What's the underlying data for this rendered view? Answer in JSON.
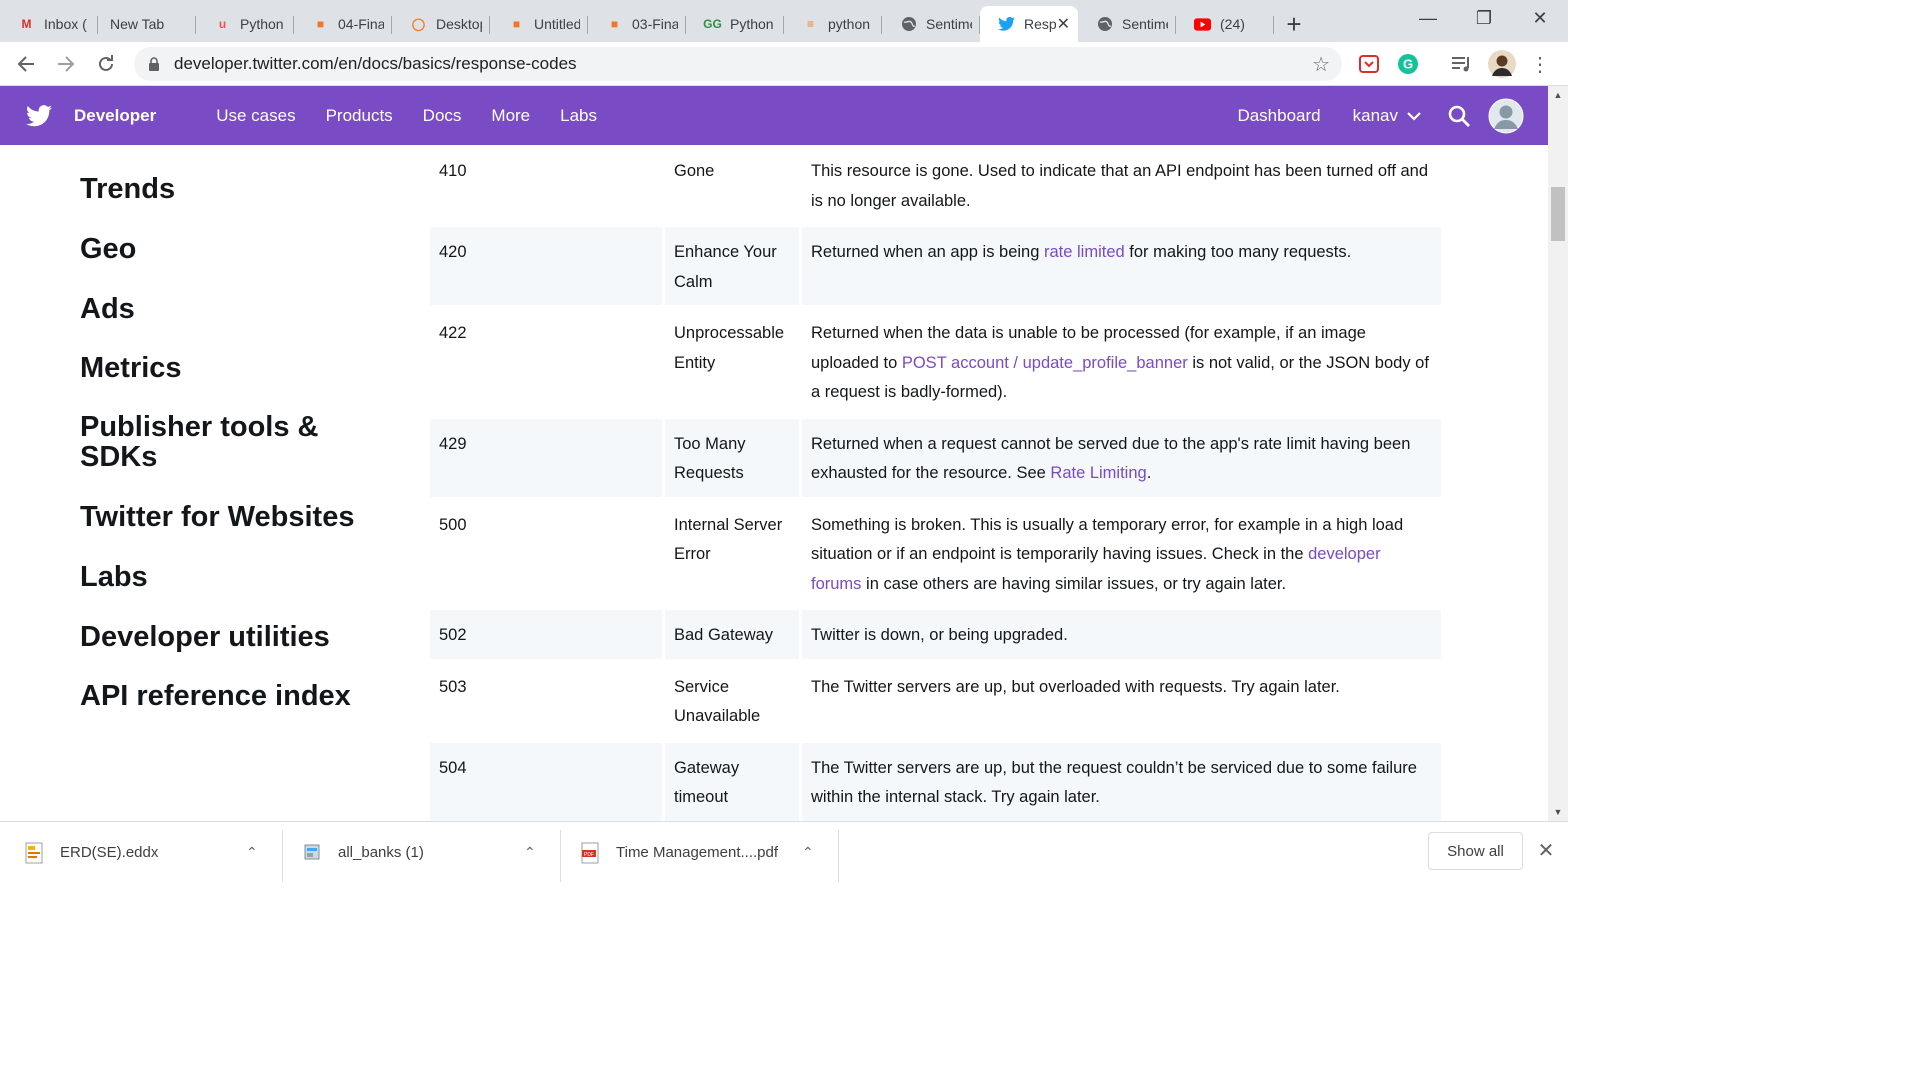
{
  "browser": {
    "tabs": [
      {
        "title": "Inbox (",
        "icon": "gmail-icon",
        "color": "#d93025"
      },
      {
        "title": "New Tab",
        "icon": "none"
      },
      {
        "title": "Python",
        "icon": "udemy-icon",
        "color": "#ec5252"
      },
      {
        "title": "04-Fina",
        "icon": "notebook-icon",
        "color": "#f37626"
      },
      {
        "title": "Desktop",
        "icon": "jupyter-icon",
        "color": "#f37626"
      },
      {
        "title": "Untitled",
        "icon": "notebook-icon",
        "color": "#f37626"
      },
      {
        "title": "03-Fina",
        "icon": "notebook-icon",
        "color": "#f37626"
      },
      {
        "title": "Python",
        "icon": "geeksforgeeks-icon",
        "color": "#2f8d46"
      },
      {
        "title": "python",
        "icon": "stackoverflow-icon",
        "color": "#f48024"
      },
      {
        "title": "Sentime",
        "icon": "globe-icon",
        "color": "#5f6368"
      },
      {
        "title": "Resp",
        "icon": "twitter-icon",
        "color": "#1da1f2",
        "active": true
      },
      {
        "title": "Sentime",
        "icon": "globe-icon",
        "color": "#5f6368"
      },
      {
        "title": "(24)",
        "icon": "youtube-icon",
        "color": "#ff0000"
      }
    ],
    "url": "developer.twitter.com/en/docs/basics/response-codes"
  },
  "header": {
    "brand": "Developer",
    "nav": [
      "Use cases",
      "Products",
      "Docs",
      "More",
      "Labs"
    ],
    "dashboard": "Dashboard",
    "user": "kanav",
    "accent": "#794bc4"
  },
  "sidebar": {
    "items": [
      "Trends",
      "Geo",
      "Ads",
      "Metrics",
      "Publisher tools & SDKs",
      "Twitter for Websites",
      "Labs",
      "Developer utilities",
      "API reference index"
    ]
  },
  "table": {
    "rows": [
      {
        "code": "410",
        "name": "Gone",
        "parts": [
          {
            "t": "This resource is gone. Used to indicate that an API endpoint has been turned off and is no longer available."
          }
        ]
      },
      {
        "code": "420",
        "name": "Enhance Your Calm",
        "parts": [
          {
            "t": "Returned when an app is being "
          },
          {
            "t": "rate limited",
            "link": true
          },
          {
            "t": " for making too many requests."
          }
        ]
      },
      {
        "code": "422",
        "name": "Unprocessable Entity",
        "parts": [
          {
            "t": "Returned when the data is unable to be processed (for example, if an image uploaded to "
          },
          {
            "t": "POST account / update_profile_banner",
            "link": true
          },
          {
            "t": " is not valid, or the JSON body of a request is badly-formed)."
          }
        ]
      },
      {
        "code": "429",
        "name": "Too Many Requests",
        "parts": [
          {
            "t": "Returned when a request cannot be served due to the app's rate limit having been exhausted for the resource. See "
          },
          {
            "t": "Rate Limiting",
            "link": true
          },
          {
            "t": "."
          }
        ]
      },
      {
        "code": "500",
        "name": "Internal Server Error",
        "parts": [
          {
            "t": "Something is broken. This is usually a temporary error, for example in a high load situation or if an endpoint is temporarily having issues. Check in the "
          },
          {
            "t": "developer forums",
            "link": true
          },
          {
            "t": " in case others are having similar issues,  or try again later."
          }
        ]
      },
      {
        "code": "502",
        "name": "Bad Gateway",
        "parts": [
          {
            "t": "Twitter is down, or being upgraded."
          }
        ]
      },
      {
        "code": "503",
        "name": "Service Unavailable",
        "parts": [
          {
            "t": "The Twitter servers are up, but overloaded with requests. Try again later."
          }
        ]
      },
      {
        "code": "504",
        "name": "Gateway timeout",
        "parts": [
          {
            "t": "The Twitter servers are up, but the request couldn’t be serviced due to some failure within the internal stack. Try again later."
          }
        ]
      }
    ]
  },
  "downloads": {
    "items": [
      {
        "name": "ERD(SE).eddx"
      },
      {
        "name": "all_banks (1)"
      },
      {
        "name": "Time Management....pdf"
      }
    ],
    "show_all": "Show all"
  }
}
